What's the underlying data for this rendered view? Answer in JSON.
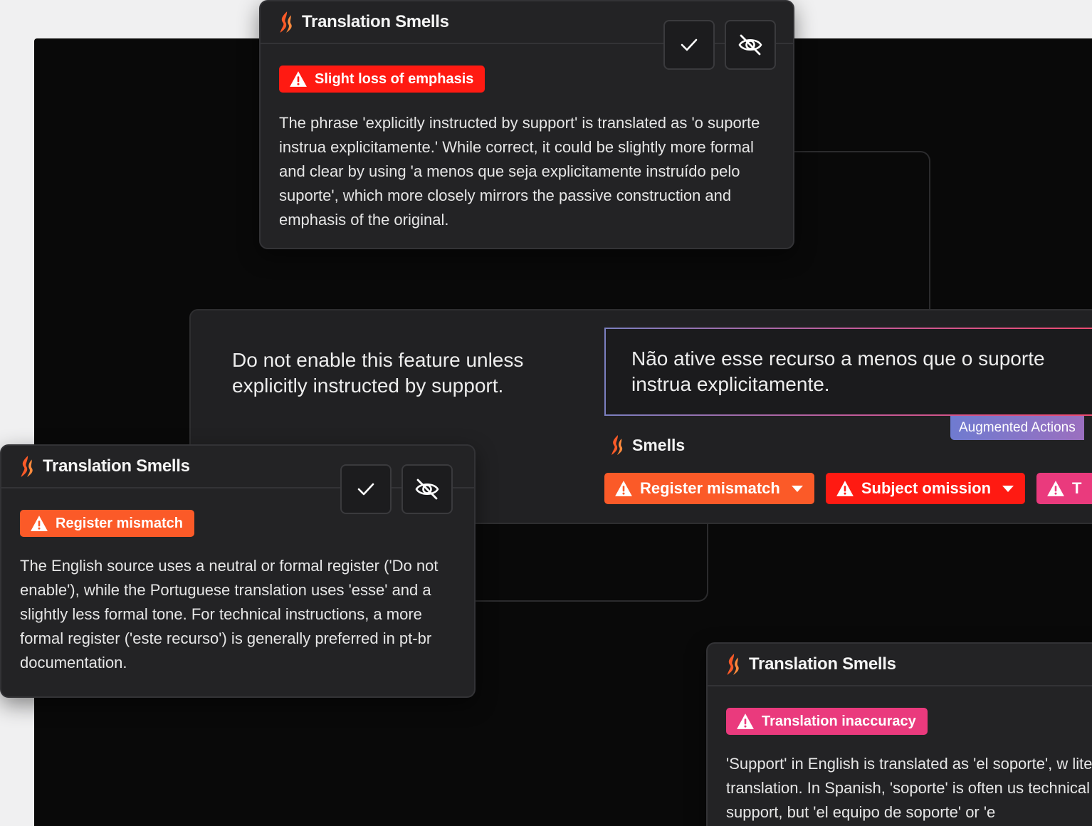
{
  "colors": {
    "brand_orange": "#fb5a28",
    "alert_red": "#ff1a12",
    "alert_pink": "#ea3a7d",
    "panel": "#232325",
    "canvas": "#090909"
  },
  "icons": {
    "logo": "flame-logo-icon",
    "warning": "warning-triangle-icon",
    "accept": "checkmark-icon",
    "ignore": "eye-slash-icon",
    "caret": "caret-down-icon"
  },
  "card_top": {
    "title": "Translation Smells",
    "badge": "Slight loss of emphasis",
    "body": "The phrase 'explicitly instructed by support' is translated as 'o suporte instrua explicitamente.' While correct, it could be slightly more formal and clear by using 'a menos que seja explicitamente instruído pelo suporte', which more closely mirrors the passive construction and emphasis of the original."
  },
  "editor": {
    "source": "Do not enable this feature unless explicitly instructed by support.",
    "target": "Não ative esse recurso a menos que o suporte instrua explicitamente.",
    "augmented_tag": "Augmented Actions",
    "smells_label": "Smells",
    "chips": [
      {
        "label": "Register mismatch"
      },
      {
        "label": "Subject omission"
      },
      {
        "label": "T"
      }
    ]
  },
  "card_left": {
    "title": "Translation Smells",
    "badge": "Register mismatch",
    "body": "The English source uses a neutral or formal register ('Do not enable'), while the Portuguese translation uses 'esse' and a slightly less formal tone. For technical instructions, a more formal register ('este recurso') is generally preferred in pt-br documentation."
  },
  "card_bottom": {
    "title": "Translation Smells",
    "badge": "Translation inaccuracy",
    "body": "'Support' in English is translated as 'el soporte', w literal translation. In Spanish, 'soporte' is often us technical support, but 'el equipo de soporte' or 'e"
  }
}
